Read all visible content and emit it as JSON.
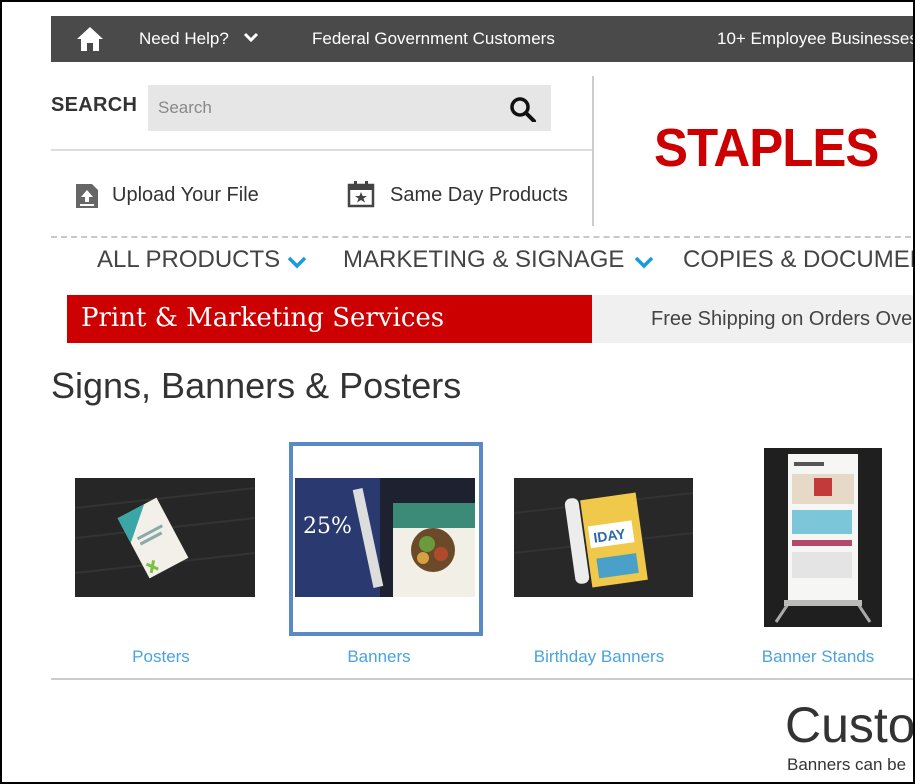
{
  "topbar": {
    "help": "Need Help?",
    "federal": "Federal Government Customers",
    "employee": "10+ Employee Businesses"
  },
  "search": {
    "label": "SEARCH",
    "placeholder": "Search"
  },
  "actions": {
    "upload": "Upload Your File",
    "same_day": "Same Day Products"
  },
  "logo": "STAPLES",
  "nav": {
    "items": [
      {
        "label": "ALL PRODUCTS"
      },
      {
        "label": "MARKETING & SIGNAGE"
      },
      {
        "label": "COPIES & DOCUMENTS"
      }
    ]
  },
  "banner": {
    "section": "Print & Marketing Services",
    "shipping": "Free Shipping on Orders Over"
  },
  "page": {
    "title": "Signs, Banners & Posters"
  },
  "products": [
    {
      "label": "Posters"
    },
    {
      "label": "Banners"
    },
    {
      "label": "Birthday Banners"
    },
    {
      "label": "Banner Stands"
    }
  ],
  "custom": {
    "heading": "Custo",
    "sub": "Banners can be"
  },
  "colors": {
    "brand": "#cc0000",
    "link": "#4aa3df",
    "topbar": "#4a4a4a",
    "selected_border": "#5a8ac6"
  }
}
